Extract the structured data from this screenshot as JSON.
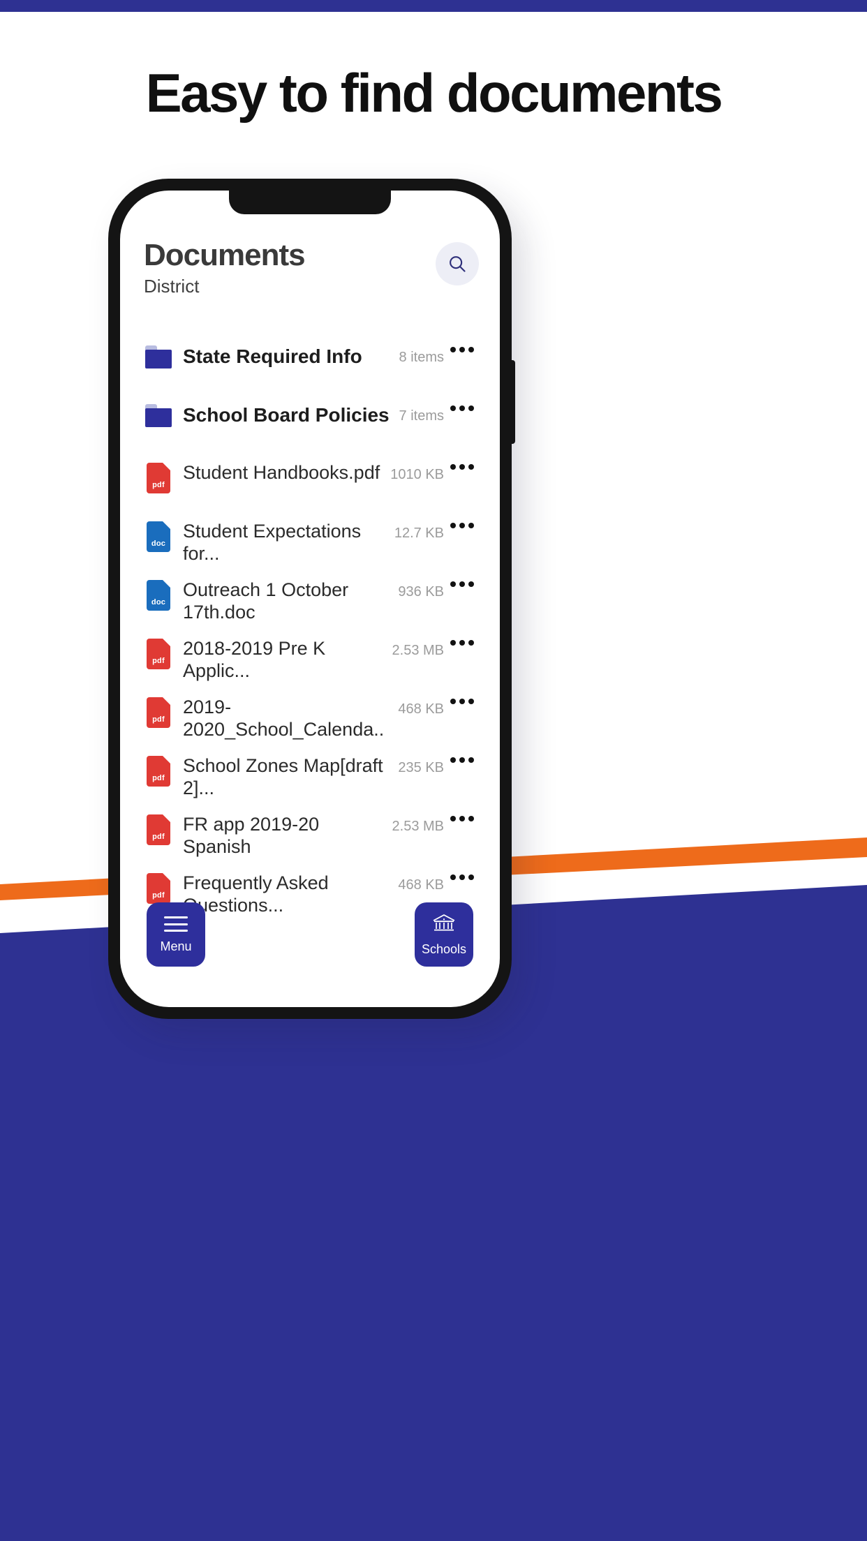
{
  "headline": "Easy to find documents",
  "colors": {
    "brand_blue": "#2e3192",
    "accent_orange": "#ee6b1b",
    "folder_blue": "#2e2f9c",
    "pdf_red": "#e03a34",
    "doc_blue": "#1a6dbd",
    "search_bg": "#edeef6"
  },
  "app": {
    "title": "Documents",
    "subtitle": "District",
    "search": {
      "icon": "search-icon",
      "label": "Search"
    },
    "rows": [
      {
        "type": "folder",
        "icon": "folder-icon",
        "name": "State Required Info",
        "meta": "8 items",
        "more": "more-options-icon"
      },
      {
        "type": "folder",
        "icon": "folder-icon",
        "name": "School Board Policies",
        "meta": "7 items",
        "more": "more-options-icon"
      },
      {
        "type": "pdf",
        "icon": "pdf-file-icon",
        "label": "pdf",
        "name": "Student Handbooks.pdf",
        "meta": "1010 KB",
        "more": "more-options-icon"
      },
      {
        "type": "doc",
        "icon": "doc-file-icon",
        "label": "doc",
        "name": "Student Expectations for...",
        "meta": "12.7 KB",
        "more": "more-options-icon"
      },
      {
        "type": "doc",
        "icon": "doc-file-icon",
        "label": "doc",
        "name": "Outreach 1 October 17th.doc",
        "meta": "936 KB",
        "more": "more-options-icon"
      },
      {
        "type": "pdf",
        "icon": "pdf-file-icon",
        "label": "pdf",
        "name": "2018-2019 Pre K Applic...",
        "meta": "2.53 MB",
        "more": "more-options-icon"
      },
      {
        "type": "pdf",
        "icon": "pdf-file-icon",
        "label": "pdf",
        "name": "2019-2020_School_Calenda..",
        "meta": "468 KB",
        "more": "more-options-icon"
      },
      {
        "type": "pdf",
        "icon": "pdf-file-icon",
        "label": "pdf",
        "name": "School Zones Map[draft 2]...",
        "meta": "235 KB",
        "more": "more-options-icon"
      },
      {
        "type": "pdf",
        "icon": "pdf-file-icon",
        "label": "pdf",
        "name": "FR app 2019-20 Spanish",
        "meta": "2.53 MB",
        "more": "more-options-icon"
      },
      {
        "type": "pdf",
        "icon": "pdf-file-icon",
        "label": "pdf",
        "name": "Frequently Asked Questions...",
        "meta": "468 KB",
        "more": "more-options-icon"
      }
    ],
    "nav": {
      "menu_label": "Menu",
      "menu_icon": "hamburger-icon",
      "schools_label": "Schools",
      "schools_icon": "school-building-icon"
    }
  }
}
